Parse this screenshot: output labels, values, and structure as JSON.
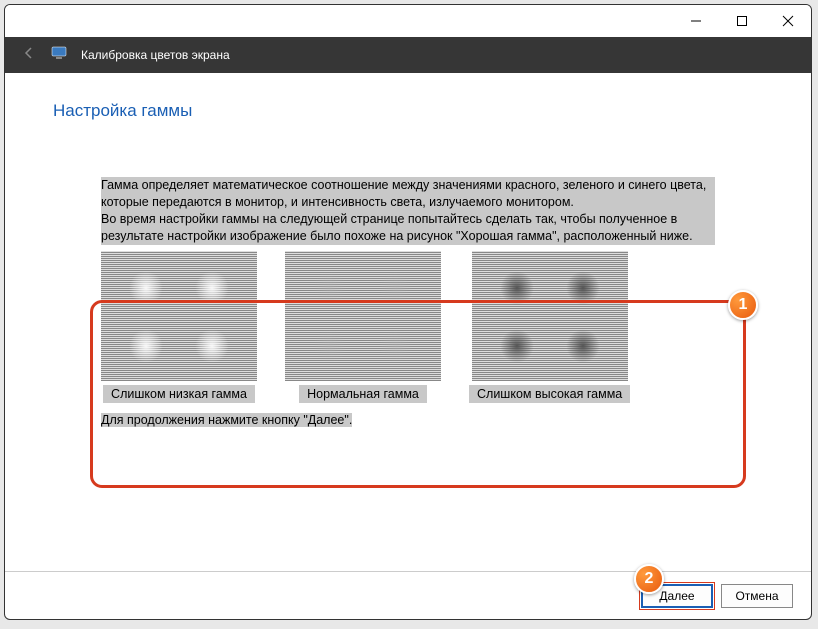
{
  "window": {
    "subtitle": "Калибровка цветов экрана"
  },
  "page": {
    "title": "Настройка гаммы",
    "paragraph1": "Гамма определяет математическое соотношение между значениями красного, зеленого и синего цвета, которые передаются в монитор, и интенсивность света, излучаемого монитором.",
    "paragraph2": "Во время настройки гаммы на следующей странице попытайтесь сделать так, чтобы полученное в результате настройки изображение было похоже на рисунок \"Хорошая гамма\", расположенный ниже.",
    "continue_text": "Для продолжения нажмите кнопку \"Далее\"."
  },
  "gamma": {
    "low": "Слишком низкая гамма",
    "normal": "Нормальная гамма",
    "high": "Слишком высокая гамма"
  },
  "footer": {
    "next": "Далее",
    "cancel": "Отмена"
  },
  "badges": {
    "one": "1",
    "two": "2"
  }
}
